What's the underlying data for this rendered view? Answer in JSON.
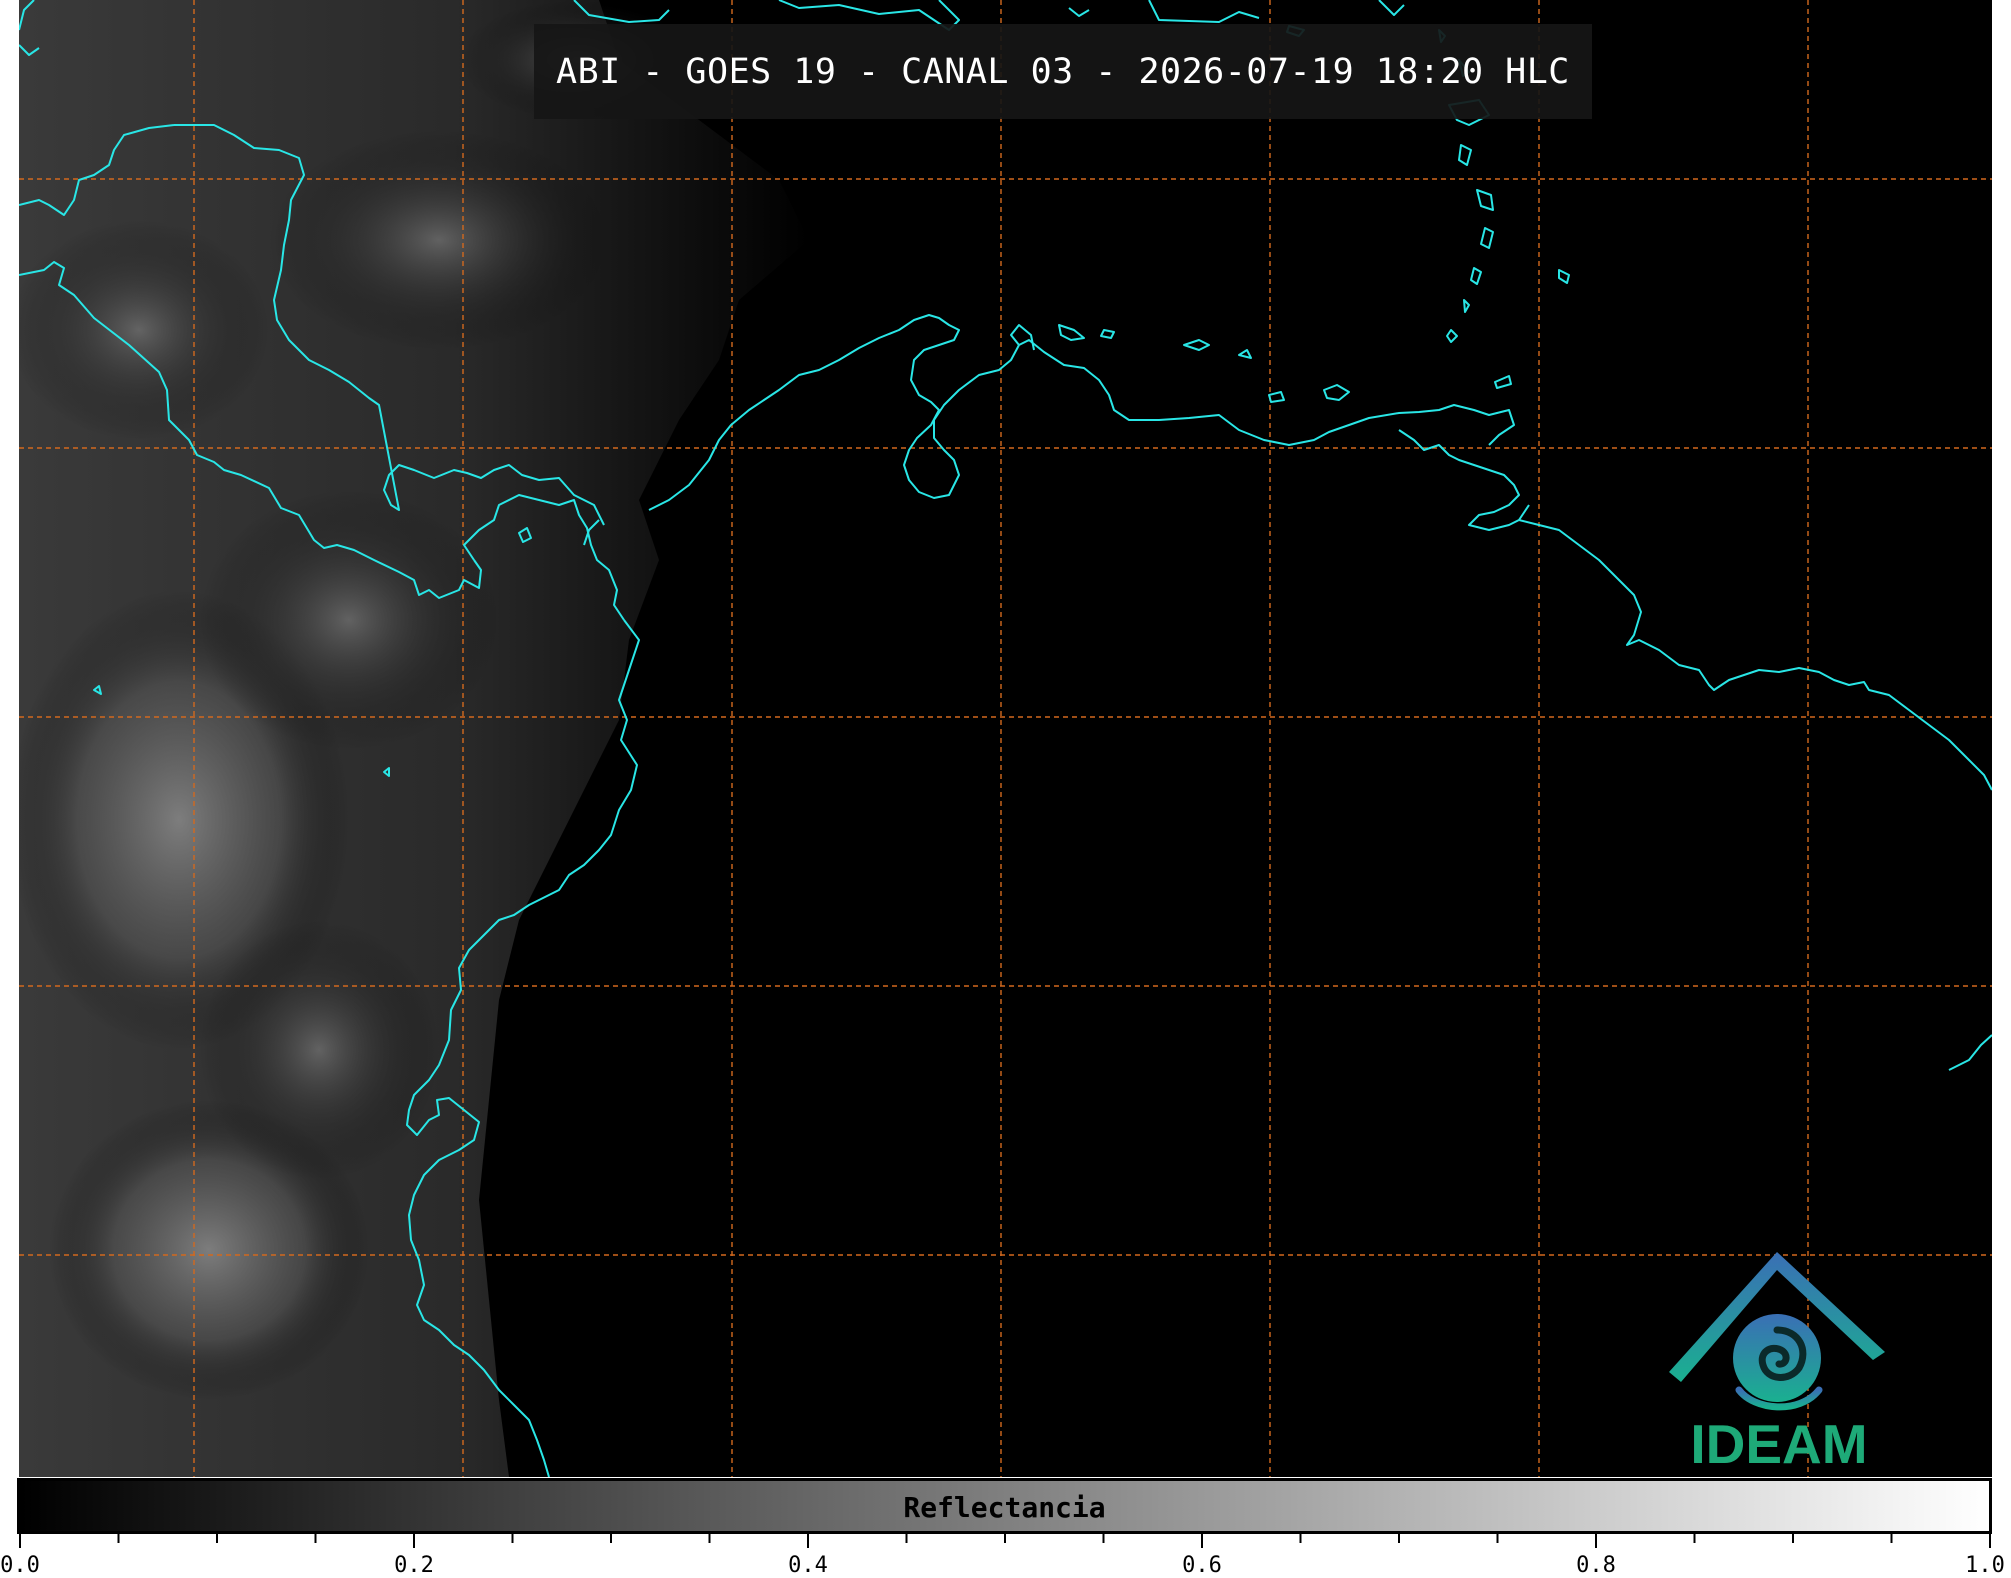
{
  "title": "ABI - GOES 19 - CANAL 03 - 2026-07-19 18:20 HLC",
  "logo": {
    "text": "IDEAM",
    "colors": {
      "roof": "#3a7fb8",
      "swirl": "#1aa58a",
      "text": "#1eaa78"
    }
  },
  "colorbar": {
    "label": "Reflectancia",
    "range": [
      0.0,
      1.0
    ],
    "gradient": [
      "#000000",
      "#ffffff"
    ],
    "tick_labels": [
      "0.0",
      "0.2",
      "0.4",
      "0.6",
      "0.8",
      "1.0"
    ]
  },
  "map": {
    "coastline_color": "#29e6e6",
    "gridline_color": "#d2691e",
    "gridline_style": "dashed",
    "background_color": "#000000"
  }
}
